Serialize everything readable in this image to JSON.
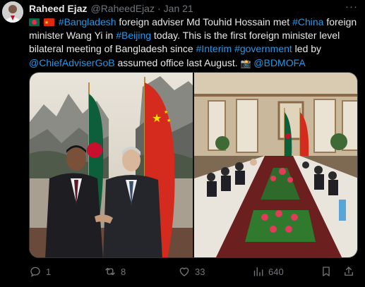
{
  "author": {
    "display_name": "Raheed Ejaz",
    "handle": "@RaheedEjaz",
    "separator": "·",
    "time": "Jan 21"
  },
  "tweet": {
    "line1": {
      "hashtag_country1": "#Bangladesh",
      "text1": " foreign adviser Md Touhid Hossain met ",
      "hashtag_country2": "#China",
      "text2": " foreign"
    },
    "line2": {
      "text1": "minister Wang Yi in ",
      "hashtag_city": "#Beijing",
      "text2": " today. This is the first foreign minister level"
    },
    "line3": {
      "text1": "bilateral meeting of Bangladesh since ",
      "hashtag_interim": "#Interim",
      "space": " ",
      "hashtag_government": "#government",
      "text2": " led by"
    },
    "line4": {
      "mention_adviser": "@ChiefAdviserGoB",
      "text1": " assumed office last August. ",
      "mention_mofa": "@BDMOFA"
    },
    "emoji": {
      "flag1": "flag-bangladesh",
      "flag2": "flag-china",
      "camera": "camera-flash-icon"
    }
  },
  "media": {
    "images": [
      "photo-handshake",
      "photo-meeting-room"
    ]
  },
  "actions": {
    "replies": "1",
    "reposts": "8",
    "likes": "33",
    "views": "640"
  },
  "colors": {
    "background": "#000000",
    "text": "#e7e9ea",
    "secondary": "#71767b",
    "link": "#1d9bf0"
  }
}
